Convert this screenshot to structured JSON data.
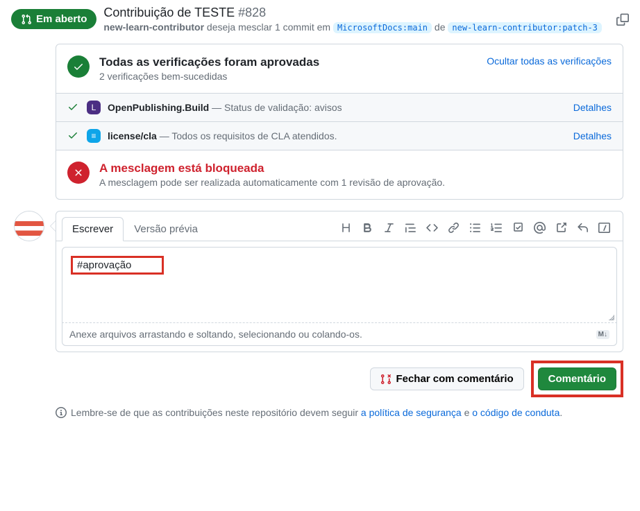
{
  "header": {
    "state_label": "Em aberto",
    "title": "Contribuição de TESTE",
    "number": "#828",
    "subline_user": "new-learn-contributor",
    "subline_action": "deseja mesclar 1 commit em",
    "base_branch": "MicrosoftDocs:main",
    "subline_from": "de",
    "compare_branch": "new-learn-contributor:patch-3"
  },
  "checks_panel": {
    "title": "Todas as verificações foram aprovadas",
    "subtitle": "2 verificações bem-sucedidas",
    "hide_link": "Ocultar todas as verificações",
    "items": [
      {
        "name": "OpenPublishing.Build",
        "status": "— Status de validação: avisos",
        "details": "Detalhes",
        "avatar_bg": "purple",
        "avatar_char": "L"
      },
      {
        "name": "license/cla",
        "status": "— Todos os requisitos de CLA atendidos.",
        "details": "Detalhes",
        "avatar_bg": "cyan",
        "avatar_char": "≡"
      }
    ]
  },
  "merge_block": {
    "title": "A mesclagem está bloqueada",
    "subtitle": "A mesclagem pode ser realizada automaticamente com 1 revisão de aprovação."
  },
  "comment": {
    "tab_write": "Escrever",
    "tab_preview": "Versão prévia",
    "text_value": "#aprovação",
    "attach_hint": "Anexe arquivos arrastando e soltando, selecionando ou colando-os.",
    "markdown_badge": "M↓"
  },
  "actions": {
    "close_label": "Fechar com comentário",
    "comment_label": "Comentário"
  },
  "footer": {
    "prefix": "Lembre-se de que as contribuições neste repositório devem seguir",
    "link1": "a política de segurança",
    "and": "e",
    "link2": "o código de conduta",
    "period": "."
  }
}
